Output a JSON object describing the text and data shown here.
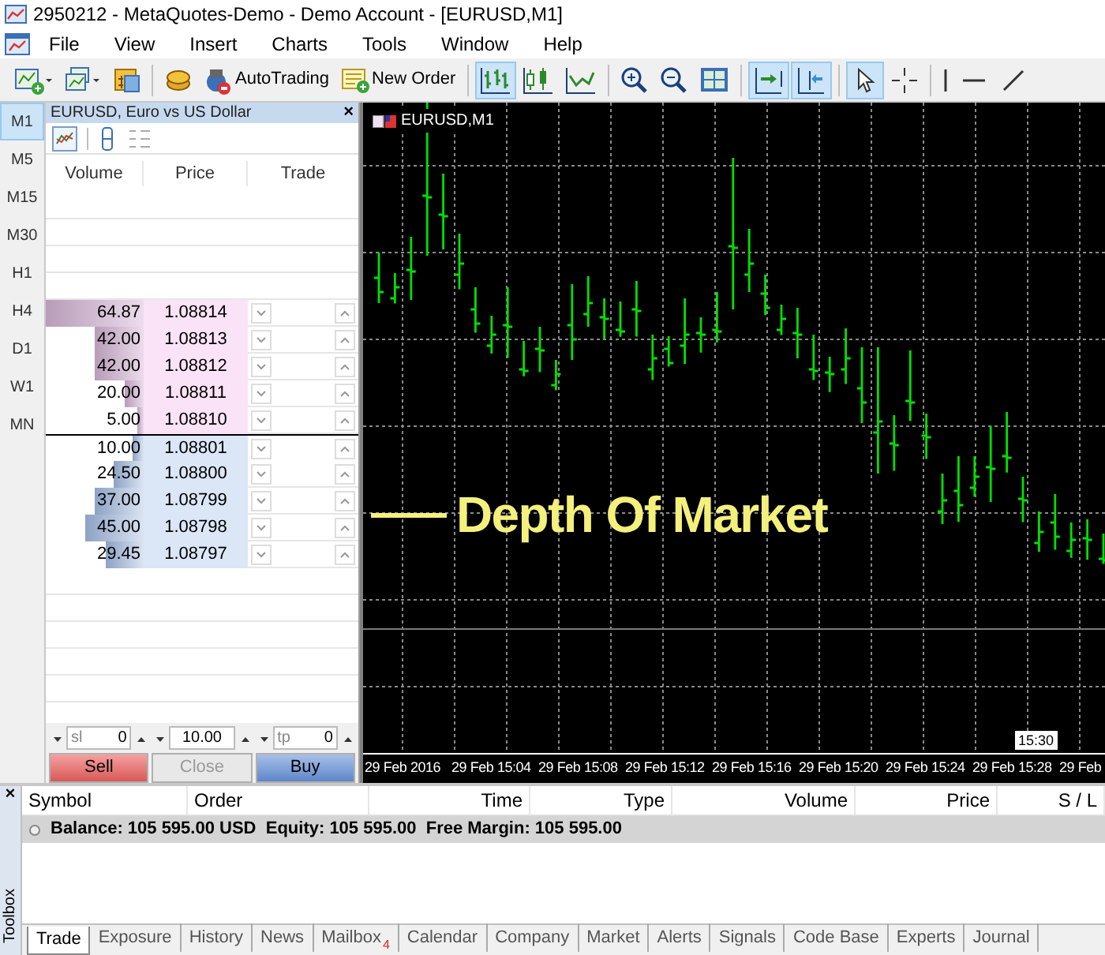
{
  "window": {
    "title": "2950212 - MetaQuotes-Demo - Demo Account - [EURUSD,M1]"
  },
  "menu": [
    "File",
    "View",
    "Insert",
    "Charts",
    "Tools",
    "Window",
    "Help"
  ],
  "toolbar": [
    {
      "kind": "new-chart",
      "selected": false
    },
    {
      "kind": "profiles",
      "selected": false
    },
    {
      "kind": "market-watch",
      "selected": false
    },
    {
      "kind": "separator"
    },
    {
      "kind": "coins",
      "selected": false
    },
    {
      "kind": "autotrading",
      "label": "AutoTrading",
      "selected": false
    },
    {
      "kind": "new-order",
      "label": "New Order",
      "selected": false
    },
    {
      "kind": "separator"
    },
    {
      "kind": "bar-chart",
      "selected": true
    },
    {
      "kind": "candles",
      "selected": false
    },
    {
      "kind": "line-chart",
      "selected": false
    },
    {
      "kind": "separator"
    },
    {
      "kind": "zoom-in",
      "selected": false
    },
    {
      "kind": "zoom-out",
      "selected": false
    },
    {
      "kind": "tile",
      "selected": false
    },
    {
      "kind": "separator"
    },
    {
      "kind": "autoscroll",
      "selected": true
    },
    {
      "kind": "chart-shift",
      "selected": true
    },
    {
      "kind": "separator"
    },
    {
      "kind": "cursor",
      "selected": true
    },
    {
      "kind": "crosshair",
      "selected": false
    },
    {
      "kind": "separator"
    },
    {
      "kind": "vline",
      "selected": false
    },
    {
      "kind": "hline",
      "selected": false
    },
    {
      "kind": "trendline",
      "selected": false
    }
  ],
  "timeframes": [
    {
      "label": "M1",
      "selected": true
    },
    {
      "label": "M5",
      "selected": false
    },
    {
      "label": "M15",
      "selected": false
    },
    {
      "label": "M30",
      "selected": false
    },
    {
      "label": "H1",
      "selected": false
    },
    {
      "label": "H4",
      "selected": false
    },
    {
      "label": "D1",
      "selected": false
    },
    {
      "label": "W1",
      "selected": false
    },
    {
      "label": "MN",
      "selected": false
    }
  ],
  "depth_of_market": {
    "title": "EURUSD, Euro vs US Dollar",
    "close": "×",
    "columns": [
      "Volume",
      "Price",
      "Trade"
    ],
    "rows": [
      {
        "kind": "ask",
        "volume": "64.87",
        "price": "1.08814",
        "level": 1.0
      },
      {
        "kind": "ask",
        "volume": "42.00",
        "price": "1.08813",
        "level": 0.5
      },
      {
        "kind": "ask",
        "volume": "42.00",
        "price": "1.08812",
        "level": 0.5
      },
      {
        "kind": "ask",
        "volume": "20.00",
        "price": "1.08811",
        "level": 0.2
      },
      {
        "kind": "ask",
        "volume": "5.00",
        "price": "1.08810",
        "level": 0.06
      },
      {
        "kind": "bid",
        "volume": "10.00",
        "price": "1.08801",
        "level": 0.12
      },
      {
        "kind": "bid",
        "volume": "24.50",
        "price": "1.08800",
        "level": 0.3
      },
      {
        "kind": "bid",
        "volume": "37.00",
        "price": "1.08799",
        "level": 0.5
      },
      {
        "kind": "bid",
        "volume": "45.00",
        "price": "1.08798",
        "level": 0.6
      },
      {
        "kind": "bid",
        "volume": "29.45",
        "price": "1.08797",
        "level": 0.38
      }
    ],
    "sl": {
      "label": "sl",
      "value": "0"
    },
    "volume": "10.00",
    "tp": {
      "label": "tp",
      "value": "0"
    },
    "buttons": [
      {
        "kind": "sell",
        "label": "Sell",
        "disabled": false
      },
      {
        "kind": "close",
        "label": "Close",
        "disabled": true
      },
      {
        "kind": "buy",
        "label": "Buy",
        "disabled": false
      }
    ]
  },
  "chart": {
    "title": "EURUSD,M1",
    "annotation": "Depth Of Market",
    "time_labels": [
      "29 Feb 2016",
      "29 Feb 15:04",
      "29 Feb 15:08",
      "29 Feb 15:12",
      "29 Feb 15:16",
      "29 Feb 15:20",
      "29 Feb 15:24",
      "29 Feb 15:28",
      "29 Feb"
    ],
    "time_marker": "15:30"
  },
  "toolbox": {
    "label": "Toolbox",
    "close": "×",
    "columns": [
      "Symbol",
      "Order",
      "Time",
      "Type",
      "Volume",
      "Price",
      "S / L"
    ],
    "balance": "Balance: 105 595.00 USD  Equity: 105 595.00  Free Margin: 105 595.00",
    "tabs": [
      {
        "label": "Trade",
        "selected": true
      },
      {
        "label": "Exposure",
        "selected": false
      },
      {
        "label": "History",
        "selected": false
      },
      {
        "label": "News",
        "selected": false
      },
      {
        "label": "Mailbox",
        "badge": "4",
        "selected": false
      },
      {
        "label": "Calendar",
        "selected": false
      },
      {
        "label": "Company",
        "selected": false
      },
      {
        "label": "Market",
        "selected": false
      },
      {
        "label": "Alerts",
        "selected": false
      },
      {
        "label": "Signals",
        "selected": false
      },
      {
        "label": "Code Base",
        "selected": false
      },
      {
        "label": "Experts",
        "selected": false
      },
      {
        "label": "Journal",
        "selected": false
      }
    ]
  }
}
